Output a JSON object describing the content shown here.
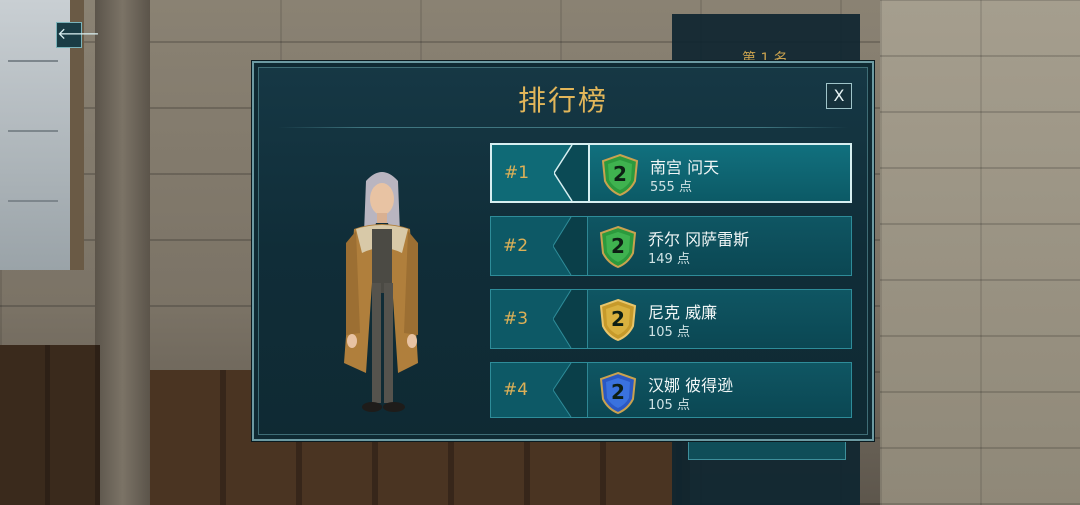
{
  "navigation": {
    "back_icon": "arrow-left-icon",
    "back_glyph": "🡐"
  },
  "background": {
    "rank_hint": "第 1 名"
  },
  "modal": {
    "title": "排行榜",
    "close_label": "X",
    "accent_color": "#e2b65a"
  },
  "avatar": {
    "icon": "player-avatar"
  },
  "leaderboard": [
    {
      "rank": "#1",
      "badge_level": "2",
      "badge_color": "green",
      "name": "南宫 问天",
      "points": "555 点",
      "selected": true
    },
    {
      "rank": "#2",
      "badge_level": "2",
      "badge_color": "green",
      "name": "乔尔 冈萨雷斯",
      "points": "149 点",
      "selected": false
    },
    {
      "rank": "#3",
      "badge_level": "2",
      "badge_color": "gold",
      "name": "尼克 威廉",
      "points": "105 点",
      "selected": false
    },
    {
      "rank": "#4",
      "badge_level": "2",
      "badge_color": "blue",
      "name": "汉娜 彼得逊",
      "points": "105 点",
      "selected": false
    }
  ]
}
